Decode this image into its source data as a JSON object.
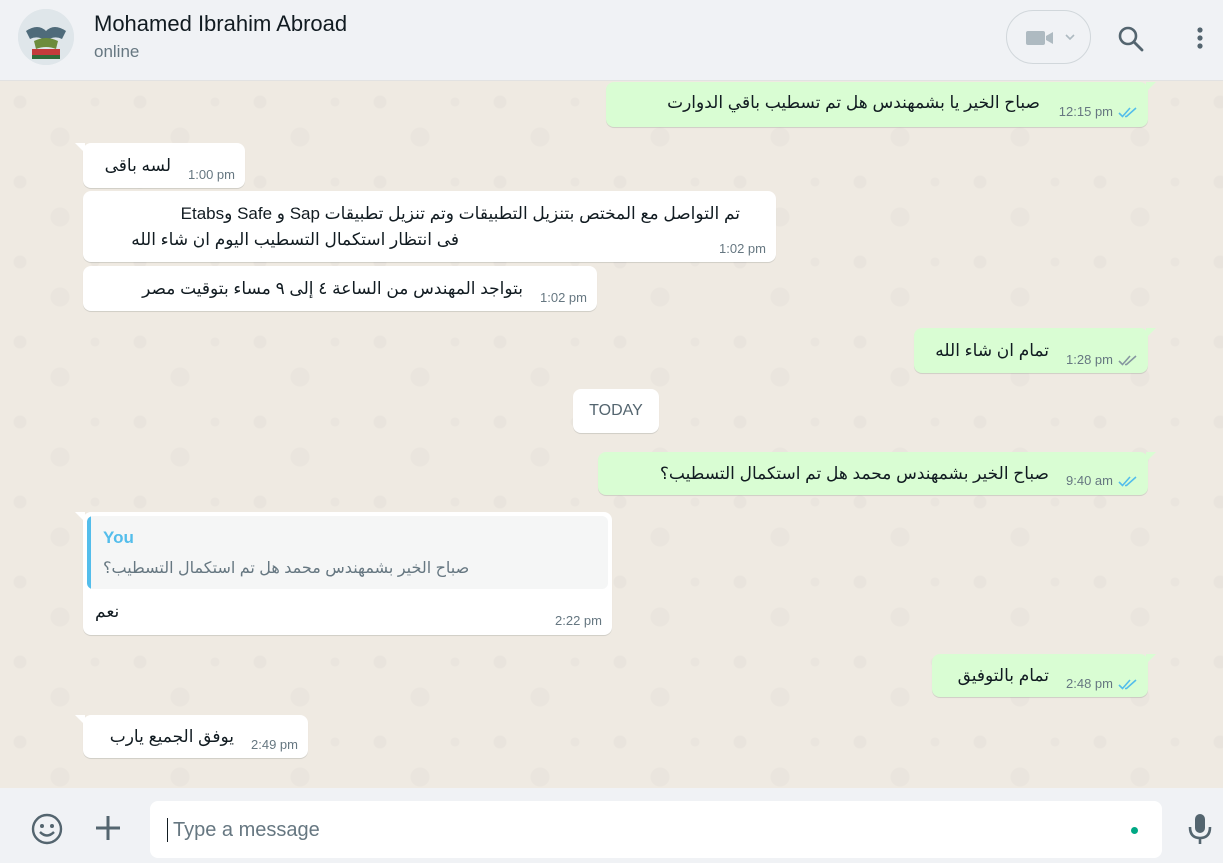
{
  "header": {
    "contact_name": "Mohamed Ibrahim Abroad",
    "status": "online"
  },
  "messages": [
    {
      "direction": "out",
      "text": "صباح الخير يا بشمهندس هل تم تسطيب باقي الدوارت",
      "time": "12:15 pm",
      "ticks": "read"
    },
    {
      "direction": "in",
      "text": "لسه باقى",
      "time": "1:00 pm"
    },
    {
      "direction": "in",
      "lines": [
        "تم التواصل مع المختص بتنزيل التطبيقات وتم تنزيل تطبيقات Sap و Safe وEtabs",
        "فى انتظار استكمال التسطيب اليوم ان شاء الله"
      ],
      "time": "1:02 pm"
    },
    {
      "direction": "in",
      "text": "بتواجد المهندس من الساعة ٤ إلى ٩ مساء بتوقيت مصر",
      "time": "1:02 pm"
    },
    {
      "direction": "out",
      "text": "تمام ان شاء الله",
      "time": "1:28 pm",
      "ticks": "delivered"
    },
    {
      "direction": "out",
      "text": "صباح الخير بشمهندس محمد هل تم استكمال التسطيب؟",
      "time": "9:40 am",
      "ticks": "read"
    },
    {
      "direction": "in",
      "quote": {
        "author": "You",
        "text": "صباح الخير بشمهندس محمد هل تم استكمال التسطيب؟"
      },
      "text": "نعم",
      "time": "2:22 pm"
    },
    {
      "direction": "out",
      "text": "تمام بالتوفيق",
      "time": "2:48 pm",
      "ticks": "read"
    },
    {
      "direction": "in",
      "text": "يوفق الجميع يارب",
      "time": "2:49 pm"
    }
  ],
  "date_divider": "TODAY",
  "composer": {
    "placeholder": "Type a message"
  },
  "colors": {
    "outgoing_bubble": "#d9fdd3",
    "incoming_bubble": "#ffffff",
    "read_ticks": "#53bdeb",
    "accent": "#00a884"
  },
  "icons": [
    "video-call-icon",
    "chevron-down-icon",
    "search-icon",
    "menu-icon",
    "emoji-icon",
    "plus-icon",
    "mic-icon"
  ]
}
